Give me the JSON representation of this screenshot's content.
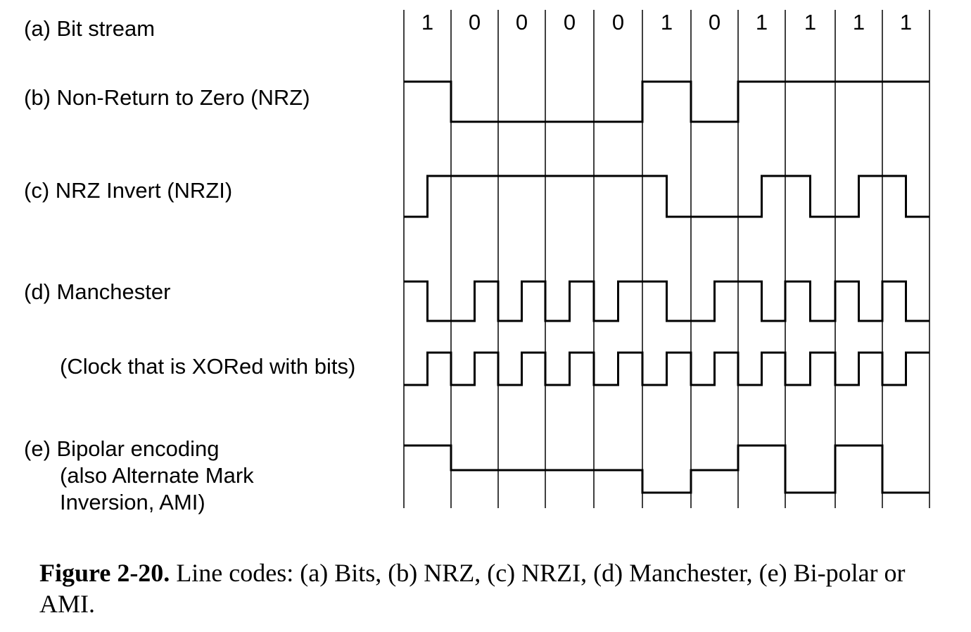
{
  "labels": {
    "a": "(a) Bit stream",
    "b": "(b) Non-Return to Zero (NRZ)",
    "c": "(c) NRZ Invert (NRZI)",
    "d": "(d) Manchester",
    "clock": "(Clock that is XORed with bits)",
    "e1": "(e) Bipolar encoding",
    "e2": "(also Alternate Mark",
    "e3": "Inversion, AMI)"
  },
  "bits": [
    "1",
    "0",
    "0",
    "0",
    "0",
    "1",
    "0",
    "1",
    "1",
    "1",
    "1"
  ],
  "caption": {
    "bold": "Figure 2-20.",
    "text": "Line codes: (a) Bits, (b) NRZ, (c) NRZI, (d) Manchester, (e) Bi-polar or AMI."
  },
  "colors": {
    "ink": "#000000",
    "background": "#ffffff"
  }
}
